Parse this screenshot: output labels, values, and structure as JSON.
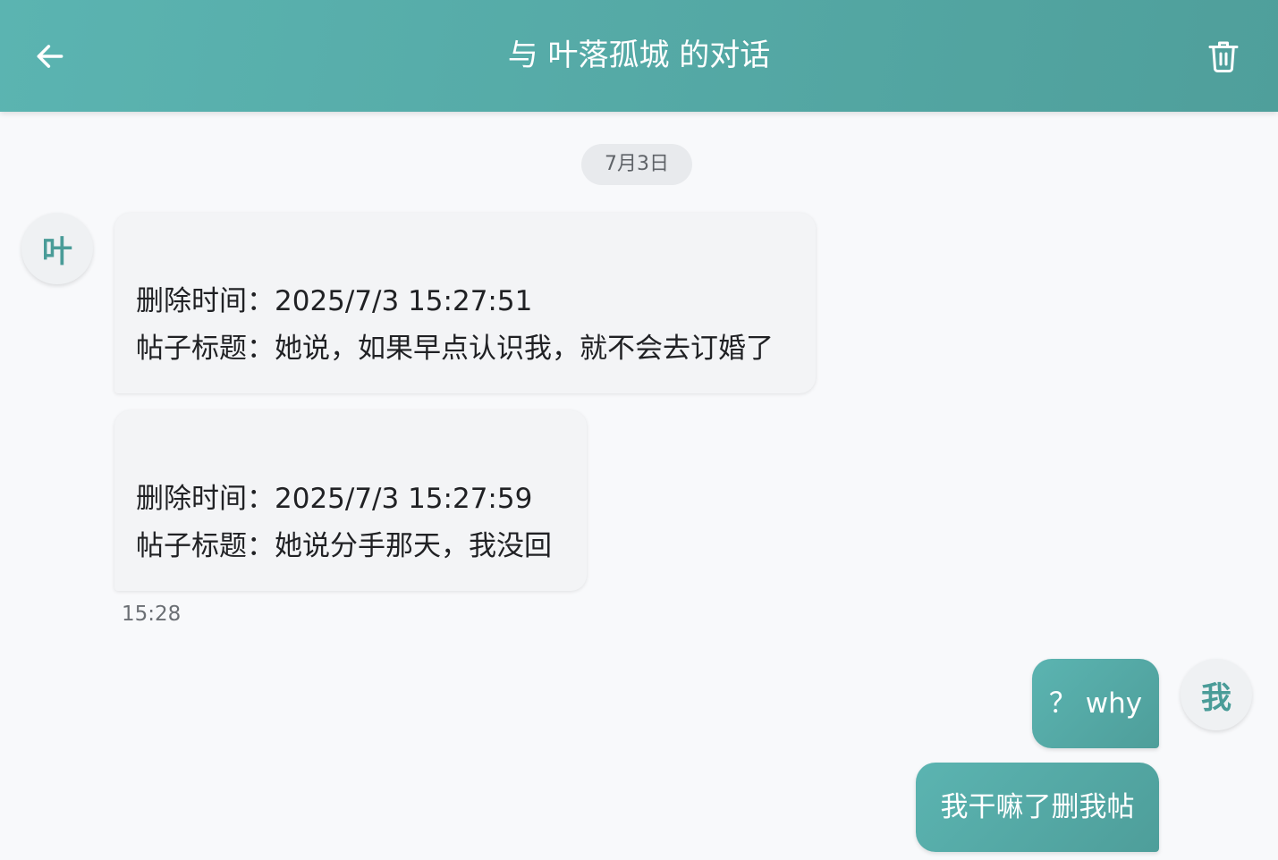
{
  "header": {
    "title": "与 叶落孤城 的对话",
    "back_icon": "arrow-left-icon",
    "delete_icon": "trash-icon"
  },
  "date_divider": "7月3日",
  "contact": {
    "avatar_text": "叶"
  },
  "me": {
    "avatar_text": "我"
  },
  "incoming_messages": [
    {
      "line1": "删除时间：2025/7/3 15:27:51",
      "line2": "帖子标题：她说，如果早点认识我，就不会去订婚了"
    },
    {
      "line1": "删除时间：2025/7/3 15:27:59",
      "line2": "帖子标题：她说分手那天，我没回"
    }
  ],
  "incoming_time": "15:28",
  "outgoing_messages": [
    {
      "text": "？ why"
    },
    {
      "text": "我干嘛了删我帖"
    }
  ],
  "colors": {
    "accent": "#55aca8",
    "background": "#f8f9fb",
    "incoming_bubble": "#f3f4f6",
    "date_pill": "#e8eaed"
  }
}
